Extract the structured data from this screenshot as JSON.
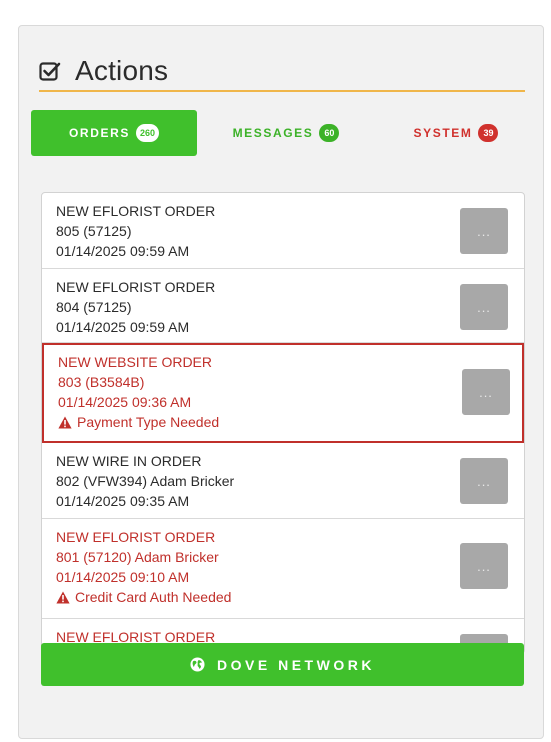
{
  "header": {
    "title": "Actions"
  },
  "tabs": [
    {
      "label": "ORDERS",
      "count": "260"
    },
    {
      "label": "MESSAGES",
      "count": "60"
    },
    {
      "label": "SYSTEM",
      "count": "39"
    }
  ],
  "orders": [
    {
      "title": "NEW EFLORIST ORDER",
      "ref": "805 (57125)",
      "datetime": "01/14/2025 09:59 AM",
      "warning": "",
      "button": "..."
    },
    {
      "title": "NEW EFLORIST ORDER",
      "ref": "804 (57125)",
      "datetime": "01/14/2025 09:59 AM",
      "warning": "",
      "button": "..."
    },
    {
      "title": "NEW WEBSITE ORDER",
      "ref": "803 (B3584B)",
      "datetime": "01/14/2025 09:36 AM",
      "warning": "Payment Type Needed",
      "button": "..."
    },
    {
      "title": "NEW WIRE IN ORDER",
      "ref": "802 (VFW394) Adam Bricker",
      "datetime": "01/14/2025 09:35 AM",
      "warning": "",
      "button": "..."
    },
    {
      "title": "NEW EFLORIST ORDER",
      "ref": "801 (57120) Adam Bricker",
      "datetime": "01/14/2025 09:10 AM",
      "warning": "Credit Card Auth Needed",
      "button": "..."
    },
    {
      "title": "NEW EFLORIST ORDER",
      "ref": "",
      "datetime": "",
      "warning": "",
      "button": ""
    }
  ],
  "footer": {
    "network_label": "DOVE NETWORK"
  },
  "colors": {
    "green": "#40c02c",
    "red": "#c0302b",
    "accent_rule": "#f0b64a"
  }
}
